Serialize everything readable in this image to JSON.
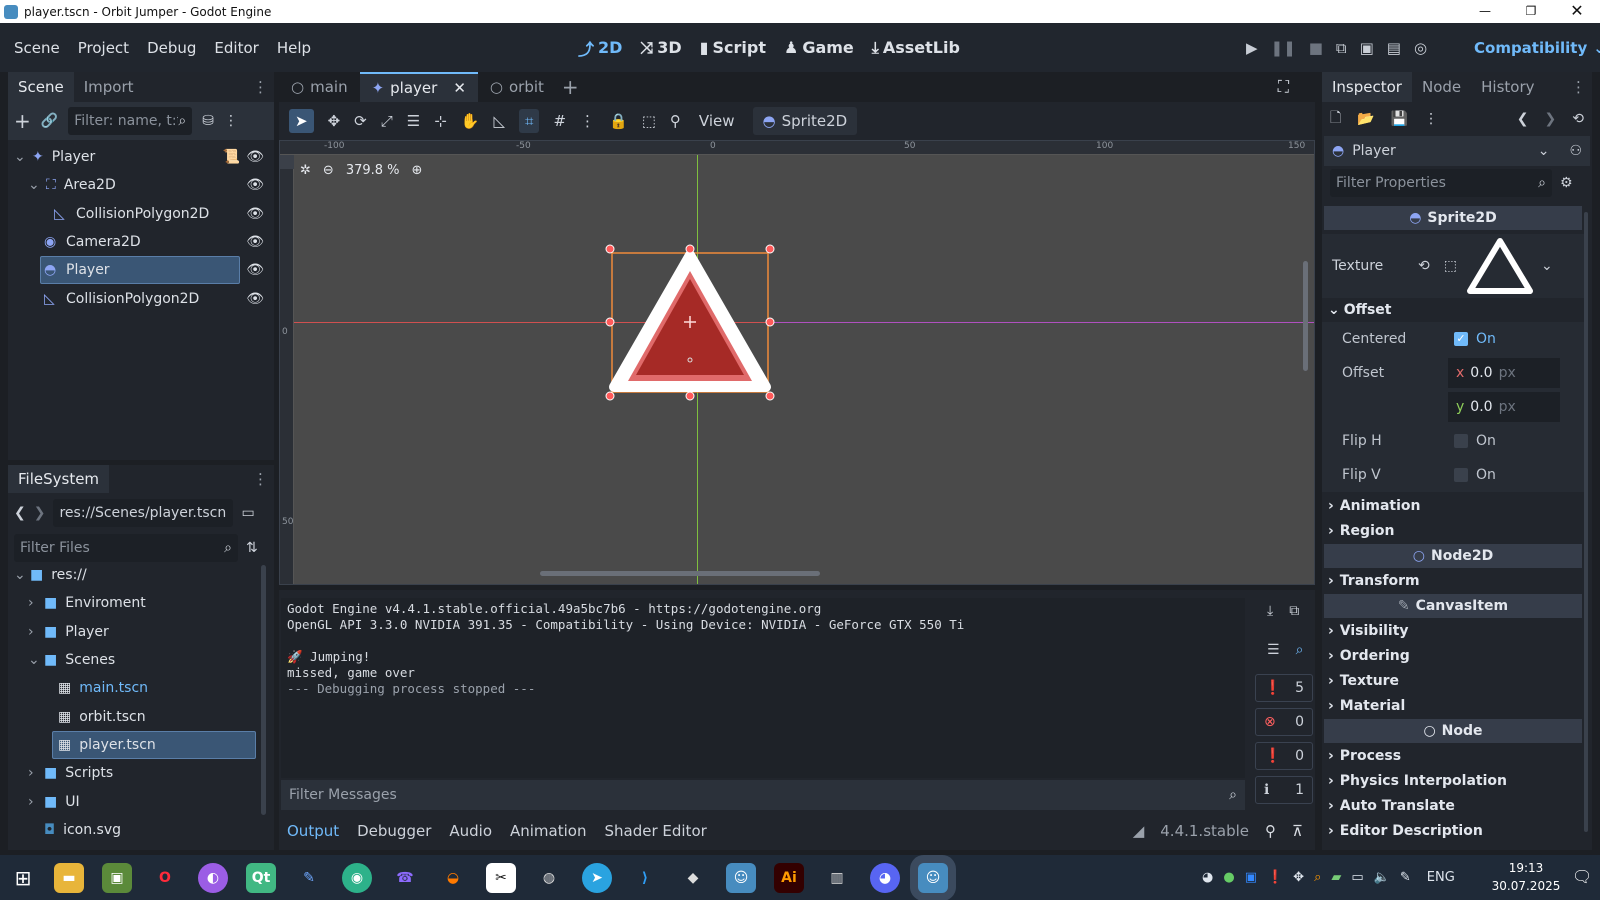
{
  "window": {
    "title": "player.tscn - Orbit Jumper - Godot Engine"
  },
  "menu": {
    "items": [
      "Scene",
      "Project",
      "Debug",
      "Editor",
      "Help"
    ],
    "workspaces": [
      "2D",
      "3D",
      "Script",
      "Game",
      "AssetLib"
    ],
    "renderer": "Compatibility"
  },
  "scene_dock": {
    "tabs": [
      "Scene",
      "Import"
    ],
    "filter_placeholder": "Filter: name, t:t",
    "nodes": [
      {
        "label": "Player",
        "icon": "player-root-icon",
        "depth": 0,
        "visible_toggle": true
      },
      {
        "label": "Area2D",
        "icon": "area2d-icon",
        "depth": 1,
        "visible_toggle": true
      },
      {
        "label": "CollisionPolygon2D",
        "icon": "collision-polygon-icon",
        "depth": 2,
        "visible_toggle": true
      },
      {
        "label": "Camera2D",
        "icon": "camera2d-icon",
        "depth": 1,
        "visible_toggle": true
      },
      {
        "label": "Player",
        "icon": "sprite2d-icon",
        "depth": 1,
        "visible_toggle": true,
        "selected": true
      },
      {
        "label": "CollisionPolygon2D",
        "icon": "collision-polygon-icon",
        "depth": 1,
        "visible_toggle": true
      }
    ]
  },
  "filesystem": {
    "tab": "FileSystem",
    "path": "res://Scenes/player.tscn",
    "filter_placeholder": "Filter Files",
    "items": [
      {
        "label": "res://",
        "type": "folder",
        "depth": 0,
        "open": true
      },
      {
        "label": "Enviroment",
        "type": "folder",
        "depth": 1
      },
      {
        "label": "Player",
        "type": "folder",
        "depth": 1
      },
      {
        "label": "Scenes",
        "type": "folder",
        "depth": 1,
        "open": true
      },
      {
        "label": "main.tscn",
        "type": "scene",
        "depth": 2,
        "highlight": true
      },
      {
        "label": "orbit.tscn",
        "type": "scene",
        "depth": 2
      },
      {
        "label": "player.tscn",
        "type": "scene",
        "depth": 2,
        "selected": true
      },
      {
        "label": "Scripts",
        "type": "folder",
        "depth": 1
      },
      {
        "label": "UI",
        "type": "folder",
        "depth": 1
      },
      {
        "label": "icon.svg",
        "type": "image",
        "depth": 1
      }
    ]
  },
  "scene_tabs": [
    {
      "label": "main",
      "active": false
    },
    {
      "label": "player",
      "active": true
    },
    {
      "label": "orbit",
      "active": false
    }
  ],
  "toolbar": {
    "view_label": "View",
    "node_label": "Sprite2D"
  },
  "viewport": {
    "zoom": "379.8 %",
    "ruler_top": [
      "-100",
      "-50",
      "0",
      "50",
      "100",
      "150"
    ],
    "ruler_left": [
      "0",
      "50"
    ]
  },
  "output": {
    "lines": [
      "Godot Engine v4.4.1.stable.official.49a5bc7b6 - https://godotengine.org",
      "OpenGL API 3.3.0 NVIDIA 391.35 - Compatibility - Using Device: NVIDIA - GeForce GTX 550 Ti",
      "",
      "🚀 Jumping!",
      "missed, game over"
    ],
    "stopped": "--- Debugging process stopped ---",
    "filter_placeholder": "Filter Messages",
    "counts": {
      "messages": "5",
      "errors": "0",
      "warnings": "0",
      "info": "1"
    },
    "bottom_tabs": [
      "Output",
      "Debugger",
      "Audio",
      "Animation",
      "Shader Editor"
    ],
    "version": "4.4.1.stable"
  },
  "inspector": {
    "tabs": [
      "Inspector",
      "Node",
      "History"
    ],
    "node_name": "Player",
    "filter_placeholder": "Filter Properties",
    "class_header": "Sprite2D",
    "texture_label": "Texture",
    "offset_section": "Offset",
    "centered_label": "Centered",
    "centered_value": "On",
    "offset_label": "Offset",
    "offset_x": "0.0",
    "offset_y": "0.0",
    "unit": "px",
    "x_label": "x",
    "y_label": "y",
    "flip_h_label": "Flip H",
    "flip_h_value": "On",
    "flip_v_label": "Flip V",
    "flip_v_value": "On",
    "sections_a": [
      "Animation",
      "Region"
    ],
    "node2d_header": "Node2D",
    "sections_b": [
      "Transform"
    ],
    "canvas_header": "CanvasItem",
    "sections_c": [
      "Visibility",
      "Ordering",
      "Texture",
      "Material"
    ],
    "node_header": "Node",
    "sections_d": [
      "Process",
      "Physics Interpolation",
      "Auto Translate",
      "Editor Description"
    ]
  },
  "taskbar": {
    "time": "19:13",
    "date": "30.07.2025",
    "lang": "ENG"
  },
  "colors": {
    "accent": "#70bafa",
    "selected": "#3a5675",
    "bg": "#21252c"
  }
}
